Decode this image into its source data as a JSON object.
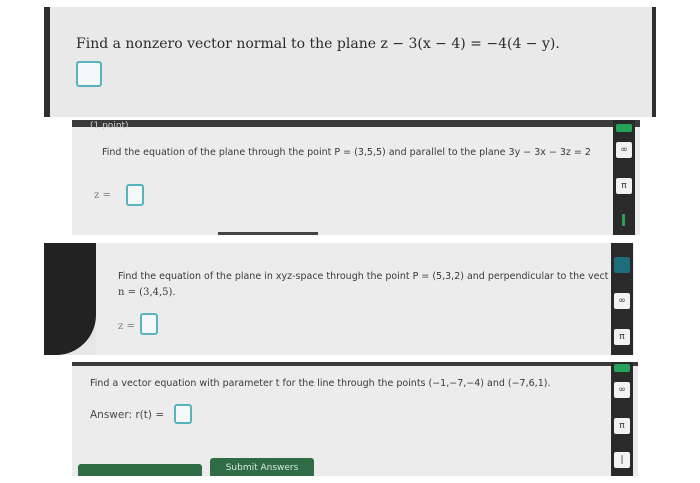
{
  "q1": {
    "question": "Find a nonzero vector normal to the plane z − 3(x − 4) = −4(4 − y)."
  },
  "q2": {
    "points": "(1 point)",
    "question": "Find the equation of the plane through the point P = (3,5,5) and parallel to the plane 3y − 3x − 3z = 2",
    "answer_label": "z ="
  },
  "q3": {
    "question_line1": "Find the equation of the plane in xyz-space through the point P = (5,3,2) and perpendicular to the vect",
    "question_line2": "n = (3,4,5).",
    "answer_label": "z ="
  },
  "q4": {
    "question": "Find a vector equation with parameter t for the line through the points (−1,−7,−4) and (−7,6,1).",
    "answer_label": "Answer: r(t) =",
    "submit_label": "Submit Answers"
  },
  "toolbar": {
    "infinity": "∞",
    "pi": "π",
    "bar": "|"
  }
}
